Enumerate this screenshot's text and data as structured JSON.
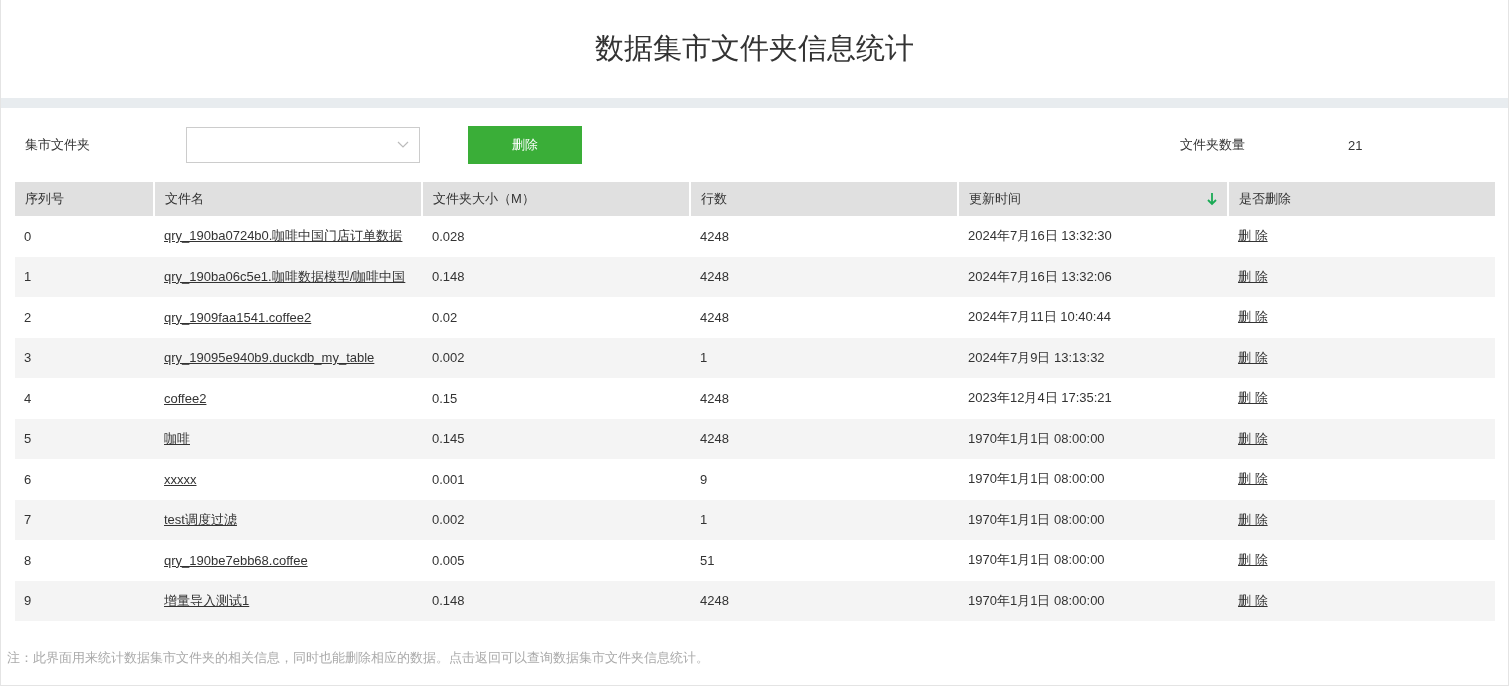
{
  "title": "数据集市文件夹信息统计",
  "filter": {
    "label": "集市文件夹",
    "delete_button": "删除",
    "count_label": "文件夹数量",
    "count": "21"
  },
  "table": {
    "columns": [
      {
        "label": "序列号"
      },
      {
        "label": "文件名"
      },
      {
        "label": "文件夹大小（M）"
      },
      {
        "label": "行数"
      },
      {
        "label": "更新时间",
        "sorted": true
      },
      {
        "label": "是否删除"
      }
    ],
    "rows": [
      {
        "index": "0",
        "name": "qry_190ba0724b0.咖啡中国门店订单数据",
        "size": "0.028",
        "lines": "4248",
        "updated": "2024年7月16日 13:32:30",
        "action": "删 除"
      },
      {
        "index": "1",
        "name": "qry_190ba06c5e1.咖啡数据模型/咖啡中国",
        "size": "0.148",
        "lines": "4248",
        "updated": "2024年7月16日 13:32:06",
        "action": "删 除"
      },
      {
        "index": "2",
        "name": "qry_1909faa1541.coffee2",
        "size": "0.02",
        "lines": "4248",
        "updated": "2024年7月11日 10:40:44",
        "action": "删 除"
      },
      {
        "index": "3",
        "name": "qry_19095e940b9.duckdb_my_table",
        "size": "0.002",
        "lines": "1",
        "updated": "2024年7月9日 13:13:32",
        "action": "删 除"
      },
      {
        "index": "4",
        "name": "coffee2",
        "size": "0.15",
        "lines": "4248",
        "updated": "2023年12月4日 17:35:21",
        "action": "删 除"
      },
      {
        "index": "5",
        "name": "咖啡",
        "size": "0.145",
        "lines": "4248",
        "updated": "1970年1月1日 08:00:00",
        "action": "删 除"
      },
      {
        "index": "6",
        "name": "xxxxx",
        "size": "0.001",
        "lines": "9",
        "updated": "1970年1月1日 08:00:00",
        "action": "删 除"
      },
      {
        "index": "7",
        "name": "test调度过滤",
        "size": "0.002",
        "lines": "1",
        "updated": "1970年1月1日 08:00:00",
        "action": "删 除"
      },
      {
        "index": "8",
        "name": "qry_190be7ebb68.coffee",
        "size": "0.005",
        "lines": "51",
        "updated": "1970年1月1日 08:00:00",
        "action": "删 除"
      },
      {
        "index": "9",
        "name": "增量导入测试1",
        "size": "0.148",
        "lines": "4248",
        "updated": "1970年1月1日 08:00:00",
        "action": "删 除"
      }
    ]
  },
  "note": "注：此界面用来统计数据集市文件夹的相关信息，同时也能删除相应的数据。点击返回可以查询数据集市文件夹信息统计。"
}
